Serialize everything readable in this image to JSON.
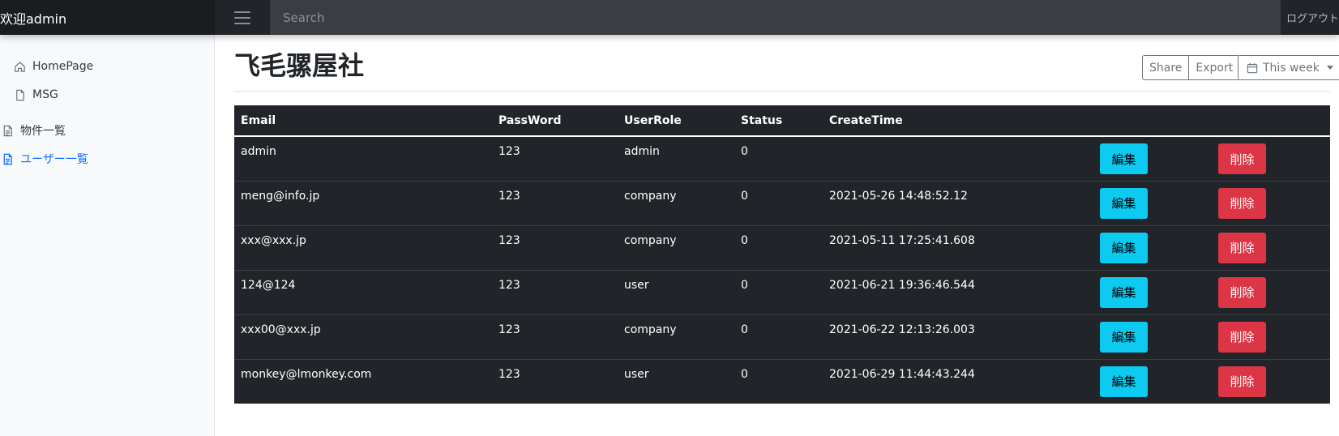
{
  "navbar": {
    "brand": "欢迎admin",
    "search_placeholder": "Search",
    "logout": "ログアウト"
  },
  "sidebar": {
    "items": [
      {
        "label": "HomePage",
        "icon": "home-icon"
      },
      {
        "label": "MSG",
        "icon": "file-icon"
      },
      {
        "label": "物件一覧",
        "icon": "file-text-icon"
      },
      {
        "label": "ユーザー一覧",
        "icon": "file-text-icon",
        "active": true
      }
    ]
  },
  "main": {
    "title": "飞毛骡屋社",
    "share_label": "Share",
    "export_label": "Export",
    "week_label": "This week"
  },
  "table": {
    "columns": [
      "Email",
      "PassWord",
      "UserRole",
      "Status",
      "CreateTime"
    ],
    "edit_label": "編集",
    "delete_label": "削除",
    "rows": [
      {
        "email": "admin",
        "password": "123",
        "role": "admin",
        "status": "0",
        "created": ""
      },
      {
        "email": "meng@info.jp",
        "password": "123",
        "role": "company",
        "status": "0",
        "created": "2021-05-26 14:48:52.12"
      },
      {
        "email": "xxx@xxx.jp",
        "password": "123",
        "role": "company",
        "status": "0",
        "created": "2021-05-11 17:25:41.608"
      },
      {
        "email": "124@124",
        "password": "123",
        "role": "user",
        "status": "0",
        "created": "2021-06-21 19:36:46.544"
      },
      {
        "email": "xxx00@xxx.jp",
        "password": "123",
        "role": "company",
        "status": "0",
        "created": "2021-06-22 12:13:26.003"
      },
      {
        "email": "monkey@lmonkey.com",
        "password": "123",
        "role": "user",
        "status": "0",
        "created": "2021-06-29 11:44:43.244"
      }
    ]
  },
  "colors": {
    "navbar": "#212529",
    "info_button": "#0dcaf0",
    "danger_button": "#dc3545",
    "active_link": "#0d6efd"
  }
}
